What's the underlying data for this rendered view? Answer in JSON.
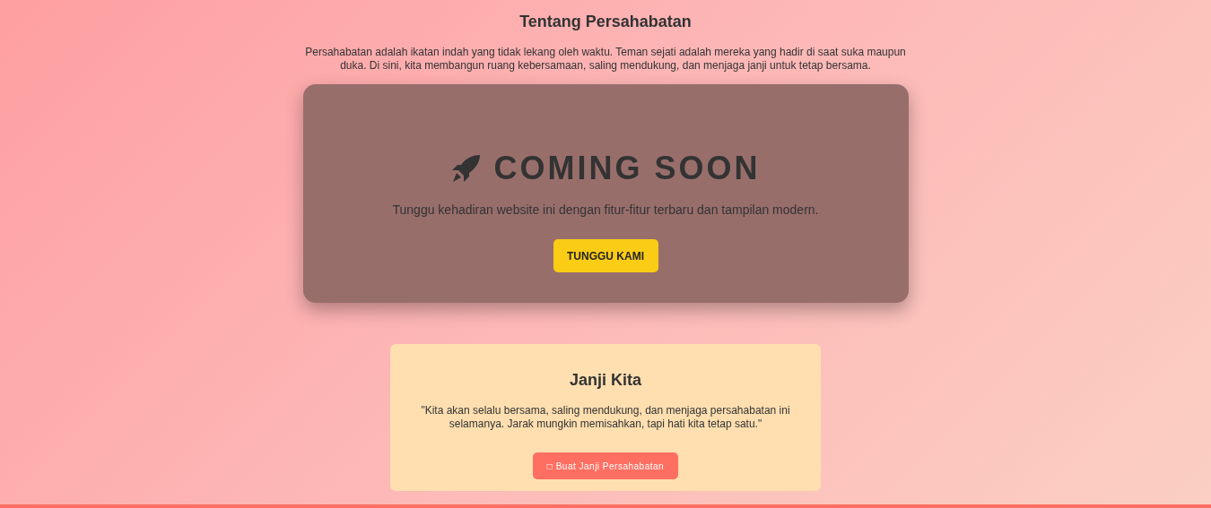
{
  "about": {
    "title": "Tentang Persahabatan",
    "text": "Persahabatan adalah ikatan indah yang tidak lekang oleh waktu. Teman sejati adalah mereka yang hadir di saat suka maupun duka. Di sini, kita membangun ruang kebersamaan, saling mendukung, dan menjaga janji untuk tetap bersama."
  },
  "coming_soon": {
    "title": "COMING SOON",
    "text": "Tunggu kehadiran website ini dengan fitur-fitur terbaru dan tampilan modern.",
    "button": "TUNGGU KAMI"
  },
  "promise": {
    "title": "Janji Kita",
    "quote": "\"Kita akan selalu bersama, saling mendukung, dan menjaga persahabatan ini selamanya. Jarak mungkin memisahkan, tapi hati kita tetap satu.\"",
    "button": "□ Buat Janji Persahabatan"
  }
}
